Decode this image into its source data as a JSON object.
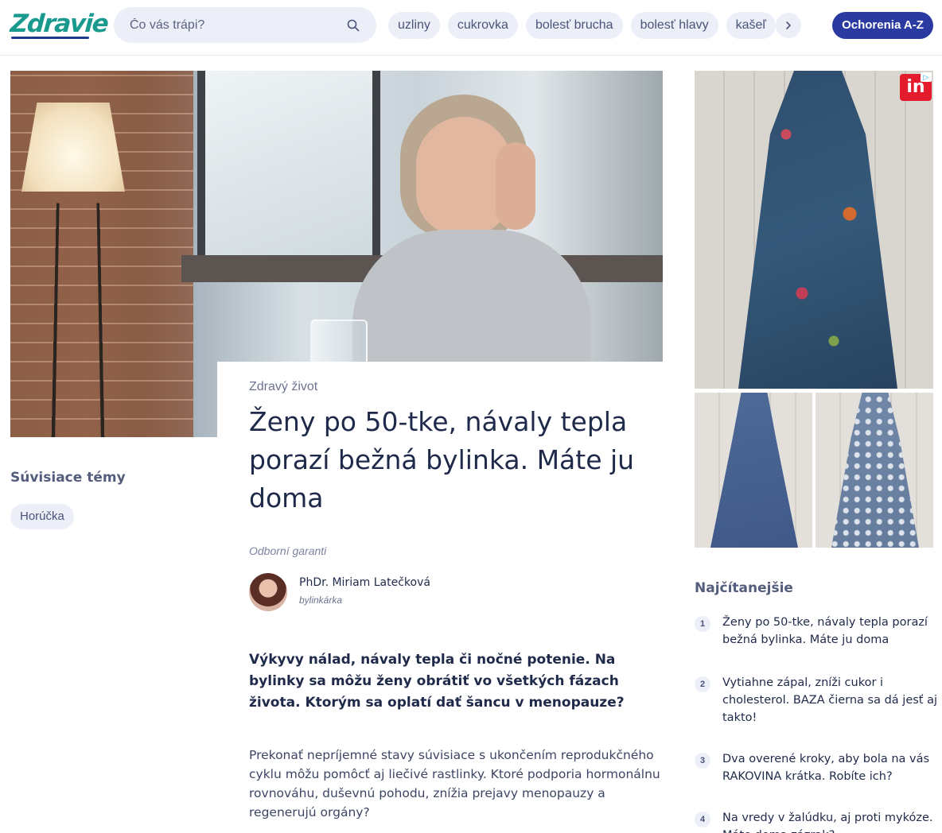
{
  "header": {
    "logo": "Zdravie",
    "search_placeholder": "Čo vás trápi?",
    "chips": [
      "uzliny",
      "cukrovka",
      "bolesť brucha",
      "bolesť hlavy",
      "kašeľ"
    ],
    "az_button": "Ochorenia A-Z"
  },
  "article": {
    "category": "Zdravý život",
    "headline": "Ženy po 50-tke, návaly tepla porazí bežná bylinka. Máte ju doma",
    "guarantors_label": "Odborní garanti",
    "author_name": "PhDr. Miriam Latečková",
    "author_role": "bylinkárka",
    "lead": "Výkyvy nálad, návaly tepla či nočné potenie. Na bylinky sa môžu ženy obrátiť vo všetkých fázach života. Ktorým sa oplatí dať šancu v menopauze?",
    "body": "Prekonať nepríjemné stavy súvisiace s ukončením reprodukčného cyklu môžu pomôcť aj liečivé rastlinky. Ktoré podporia hormonálnu rovnováhu, duševnú pohodu, znížia prejavy menopauzy a regenerujú orgány?"
  },
  "related": {
    "title": "Súvisiace témy",
    "chips": [
      "Horúčka"
    ]
  },
  "ad": {
    "badge": "in"
  },
  "mostread": {
    "title": "Najčítanejšie",
    "items": [
      {
        "num": "1",
        "text": "Ženy po 50-tke, návaly tepla porazí bežná bylinka. Máte ju doma"
      },
      {
        "num": "2",
        "text": "Vytiahne zápal, zníži cukor i cholesterol. BAZA čierna sa dá jesť aj takto!"
      },
      {
        "num": "3",
        "text": "Dva overené kroky, aby bola na vás RAKOVINA krátka. Robíte ich?"
      },
      {
        "num": "4",
        "text": "Na vredy v žalúdku, aj proti mykóze. Máte doma zázrak?"
      }
    ]
  }
}
